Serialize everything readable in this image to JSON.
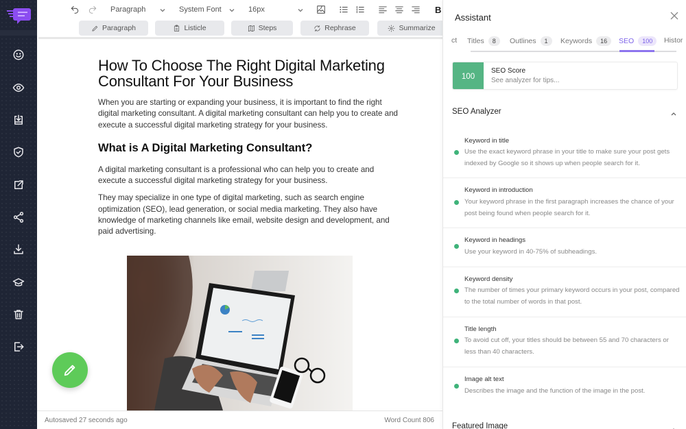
{
  "sidebar": {
    "logo": "chat-bubble-logo",
    "items": [
      {
        "icon": "smiley-icon",
        "label": "Tone"
      },
      {
        "icon": "eye-icon",
        "label": "Preview"
      },
      {
        "icon": "import-icon",
        "label": "Import"
      },
      {
        "icon": "shield-check-icon",
        "label": "Plagiarism"
      },
      {
        "icon": "external-link-icon",
        "label": "Open"
      },
      {
        "icon": "share-icon",
        "label": "Share"
      },
      {
        "icon": "download-icon",
        "label": "Download"
      },
      {
        "icon": "graduation-cap-icon",
        "label": "Learn"
      },
      {
        "icon": "trash-icon",
        "label": "Delete"
      },
      {
        "icon": "exit-icon",
        "label": "Exit"
      }
    ]
  },
  "toolbar": {
    "block_type": "Paragraph",
    "font_family": "System Font",
    "font_size": "16px",
    "bold_label": "B"
  },
  "ai_actions": [
    {
      "label": "Paragraph",
      "icon": "pencil-icon"
    },
    {
      "label": "Listicle",
      "icon": "clipboard-icon"
    },
    {
      "label": "Steps",
      "icon": "map-icon"
    },
    {
      "label": "Rephrase",
      "icon": "refresh-icon"
    },
    {
      "label": "Summarize",
      "icon": "gear-icon"
    }
  ],
  "document": {
    "title": "How To Choose The Right Digital Marketing Consultant For Your Business",
    "intro": "When you are starting or expanding your business, it is important to find the right digital marketing consultant. A digital marketing consultant can help you to create and execute a successful digital marketing strategy for your business.",
    "heading": "What is A Digital Marketing Consultant?",
    "para2": "A digital marketing consultant is a professional who can help you to create and execute a successful digital marketing strategy for your business.",
    "para3": "They may specialize in one type of digital marketing, such as search engine optimization (SEO), lead generation, or social media marketing. They also have knowledge of marketing channels like email, website design and development, and paid advertising.",
    "image_alt": "Person typing on a laptop showing analytics dashboard"
  },
  "status": {
    "autosave": "Autosaved 27 seconds ago",
    "word_count": "Word Count 806"
  },
  "assistant": {
    "title": "Assistant",
    "tabs": [
      {
        "label": "ct",
        "badge": null
      },
      {
        "label": "Titles",
        "badge": "8"
      },
      {
        "label": "Outlines",
        "badge": "1"
      },
      {
        "label": "Keywords",
        "badge": "16"
      },
      {
        "label": "SEO",
        "badge": "100",
        "active": true
      },
      {
        "label": "Histor",
        "badge": null
      }
    ],
    "seo_score": {
      "value": "100",
      "title": "SEO Score",
      "subtitle": "See analyzer for tips..."
    },
    "analyzer_title": "SEO Analyzer",
    "analyzer_items": [
      {
        "title": "Keyword in title",
        "desc": "Use the exact keyword phrase in your title to make sure your post gets indexed by Google so it shows up when people search for it.",
        "status": "pass"
      },
      {
        "title": "Keyword in introduction",
        "desc": "Your keyword phrase in the first paragraph increases the chance of your post being found when people search for it.",
        "status": "pass"
      },
      {
        "title": "Keyword in headings",
        "desc": "Use your keyword in 40-75% of subheadings.",
        "status": "pass"
      },
      {
        "title": "Keyword density",
        "desc": "The number of times your primary keyword occurs in your post, compared to the total number of words in that post.",
        "status": "pass"
      },
      {
        "title": "Title length",
        "desc": "To avoid cut off, your titles should be between 55 and 70 characters or less than 40 characters.",
        "status": "pass"
      },
      {
        "title": "Image alt text",
        "desc": "Describes the image and the function of the image in the post.",
        "status": "pass"
      }
    ],
    "featured_image_title": "Featured Image"
  },
  "colors": {
    "sidebar_bg": "#1f2535",
    "accent": "#7b61e8",
    "score_green": "#55b584",
    "pass_dot": "#3fb37a",
    "fab_green": "#5ecb59"
  }
}
